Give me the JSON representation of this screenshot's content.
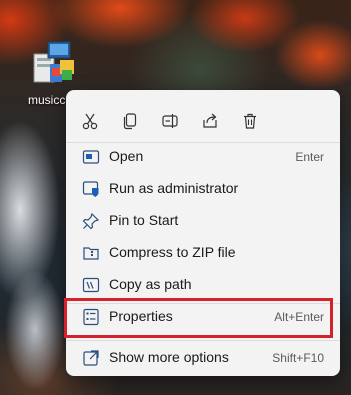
{
  "desktop": {
    "icon_label": "musicc",
    "icon_name": "installer-icon"
  },
  "context_menu": {
    "quick_actions": [
      {
        "name": "cut-icon"
      },
      {
        "name": "copy-icon"
      },
      {
        "name": "rename-icon"
      },
      {
        "name": "share-icon"
      },
      {
        "name": "delete-icon"
      }
    ],
    "items": [
      {
        "label": "Open",
        "shortcut": "Enter",
        "icon": "open-icon"
      },
      {
        "label": "Run as administrator",
        "shortcut": "",
        "icon": "shield-icon"
      },
      {
        "label": "Pin to Start",
        "shortcut": "",
        "icon": "pin-icon"
      },
      {
        "label": "Compress to ZIP file",
        "shortcut": "",
        "icon": "zip-icon"
      },
      {
        "label": "Copy as path",
        "shortcut": "",
        "icon": "copy-path-icon"
      },
      {
        "label": "Properties",
        "shortcut": "Alt+Enter",
        "icon": "properties-icon"
      },
      {
        "label": "Show more options",
        "shortcut": "Shift+F10",
        "icon": "more-options-icon"
      }
    ],
    "highlighted_item": "Properties",
    "highlight_color": "#d6202c",
    "accent_color": "#1a5fb4"
  }
}
